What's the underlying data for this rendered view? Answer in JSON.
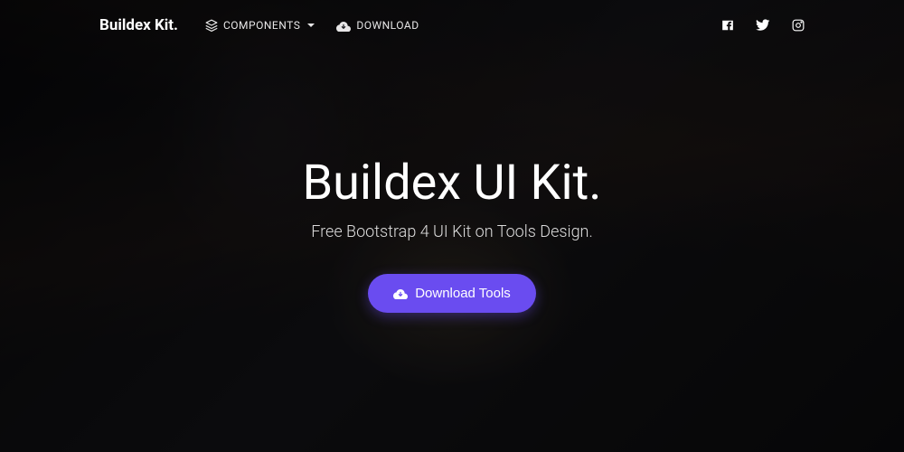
{
  "brand": "Buildex Kit.",
  "nav": {
    "components_label": "COMPONENTS",
    "download_label": "DOWNLOAD"
  },
  "hero": {
    "title": "Buildex UI Kit.",
    "subtitle": "Free Bootstrap 4 UI Kit on Tools Design.",
    "cta_label": "Download Tools"
  },
  "colors": {
    "accent": "#6a4cf0"
  }
}
